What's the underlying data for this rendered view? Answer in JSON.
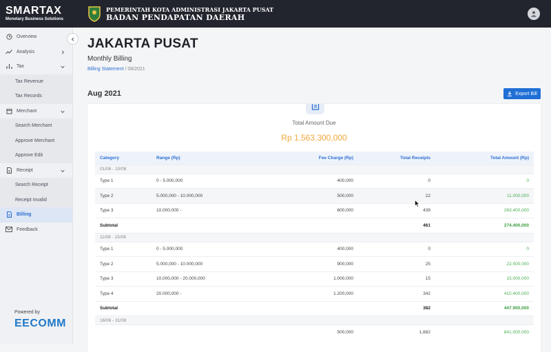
{
  "brand": {
    "name": "SMARTAX",
    "tagline": "Monetary Business Solutions"
  },
  "header": {
    "line1": "PEMERINTAH KOTA ADMINISTRASI JAKARTA PUSAT",
    "line2": "BADAN PENDAPATAN DAERAH"
  },
  "sidebar": {
    "items": [
      {
        "label": "Overview",
        "icon": "clock-icon"
      },
      {
        "label": "Analysis",
        "icon": "trend-icon"
      },
      {
        "label": "Tax",
        "icon": "bar-chart-icon"
      },
      {
        "label": "Tax Revenue"
      },
      {
        "label": "Tax Records"
      },
      {
        "label": "Merchant",
        "icon": "store-icon"
      },
      {
        "label": "Search Merchant"
      },
      {
        "label": "Approve Merchant"
      },
      {
        "label": "Approve Edit"
      },
      {
        "label": "Receipt",
        "icon": "receipt-icon"
      },
      {
        "label": "Search Receipt"
      },
      {
        "label": "Receipt Invalid"
      },
      {
        "label": "Billing",
        "icon": "document-icon"
      },
      {
        "label": "Feedback",
        "icon": "mail-icon"
      }
    ],
    "powered_by": "Powered by",
    "powered_brand": "EECOMM"
  },
  "page": {
    "title": "JAKARTA PUSAT",
    "subtitle": "Monthly Billing",
    "breadcrumb_link": "Billing Statement",
    "breadcrumb_current": " / 08/2021",
    "period": "Aug 2021",
    "export_label": "Export Bill"
  },
  "summary": {
    "label": "Total Amount Due",
    "value": "Rp 1.563.300,000"
  },
  "table": {
    "headers": [
      "Category",
      "Range (Rp)",
      "Fee Charge (Rp)",
      "Total Receipts",
      "Total Amount (Rp)"
    ],
    "group1": "01/08 - 10/08",
    "g1rows": [
      [
        "Type 1",
        "0 - 5.000,000",
        "400,000",
        "0",
        "0"
      ],
      [
        "Type 2",
        "5.000,000 - 10.000,000",
        "500,000",
        "22",
        "11.000,000"
      ],
      [
        "Type 3",
        "10.000,000 -",
        "600,000",
        "439",
        "263.400,000"
      ]
    ],
    "g1subtotal": [
      "Subtotal",
      "461",
      "274.400,000"
    ],
    "group2": "11/08 - 15/08",
    "g2rows": [
      [
        "Type 1",
        "0 - 5.000,000",
        "400,000",
        "0",
        "0"
      ],
      [
        "Type 2",
        "5.000,000 - 10.000,000",
        "900,000",
        "25",
        "22.500,000"
      ],
      [
        "Type 3",
        "10.000,000 - 20.000,000",
        "1.000,000",
        "15",
        "15.000,000"
      ],
      [
        "Type 4",
        "20.000,000 -",
        "1.200,000",
        "342",
        "410.400,000"
      ]
    ],
    "g2subtotal": [
      "Subtotal",
      "382",
      "447.900,000"
    ],
    "group3": "16/08 - 31/08",
    "g3rows": [
      [
        "",
        "",
        "500,000",
        "1,682",
        "841.000,000"
      ]
    ]
  },
  "colors": {
    "accent": "#1f6fd6",
    "amount_due": "#f0a83a",
    "positive": "#4bae4f",
    "topbar": "#22252e"
  }
}
